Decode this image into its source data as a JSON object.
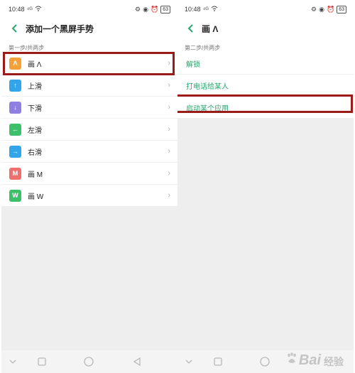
{
  "left": {
    "status": {
      "time": "10:48",
      "signal": "⁴ᴳ",
      "battery": "63"
    },
    "title": "添加一个黑屏手势",
    "section": "第一步/共两步",
    "items": [
      {
        "icon_text": "Λ",
        "icon_color": "#f5a13a",
        "label": "画 Λ",
        "icon_name": "caret-gesture-icon"
      },
      {
        "icon_text": "↑",
        "icon_color": "#33a6ea",
        "label": "上滑",
        "icon_name": "arrow-up-icon"
      },
      {
        "icon_text": "↓",
        "icon_color": "#8f7fe0",
        "label": "下滑",
        "icon_name": "arrow-down-icon"
      },
      {
        "icon_text": "←",
        "icon_color": "#3cc06a",
        "label": "左滑",
        "icon_name": "arrow-left-icon"
      },
      {
        "icon_text": "→",
        "icon_color": "#33a6ea",
        "label": "右滑",
        "icon_name": "arrow-right-icon"
      },
      {
        "icon_text": "M",
        "icon_color": "#ef6f6f",
        "label": "画 M",
        "icon_name": "m-gesture-icon"
      },
      {
        "icon_text": "W",
        "icon_color": "#3cc06a",
        "label": "画 W",
        "icon_name": "w-gesture-icon"
      }
    ]
  },
  "right": {
    "status": {
      "time": "10:48",
      "signal": "⁴ᴳ",
      "battery": "63"
    },
    "title": "画 Λ",
    "section": "第二步/共两步",
    "items": [
      {
        "label": "解锁"
      },
      {
        "label": "打电话给某人"
      },
      {
        "label": "启动某个应用"
      }
    ]
  },
  "watermark": {
    "brand": "Bai",
    "sub": "经验"
  },
  "colors": {
    "accent_green": "#2aa56e",
    "highlight_red": "#9b1b1b"
  }
}
